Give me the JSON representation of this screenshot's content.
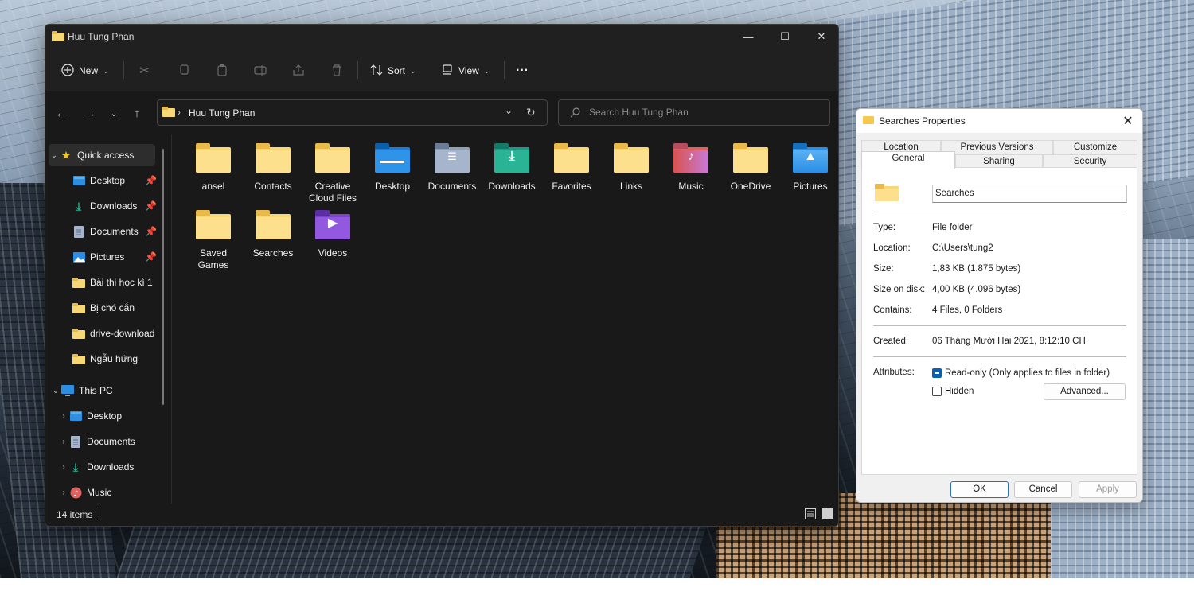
{
  "explorer": {
    "title": "Huu Tung Phan",
    "toolbar": {
      "new_label": "New",
      "sort_label": "Sort",
      "view_label": "View",
      "more_label": "···"
    },
    "address": {
      "path": "Huu Tung Phan",
      "search_placeholder": "Search Huu Tung Phan"
    },
    "sidebar": [
      {
        "label": "Quick access",
        "icon": "star-icon",
        "expanded": true,
        "selected": true
      },
      {
        "label": "Desktop",
        "icon": "desktop-icon",
        "pinned": true
      },
      {
        "label": "Downloads",
        "icon": "download-icon",
        "pinned": true
      },
      {
        "label": "Documents",
        "icon": "documents-icon",
        "pinned": true
      },
      {
        "label": "Pictures",
        "icon": "pictures-icon",
        "pinned": true
      },
      {
        "label": "Bài thi học kì 1",
        "icon": "folder-icon"
      },
      {
        "label": "Bị chó cắn",
        "icon": "folder-icon"
      },
      {
        "label": "drive-download",
        "icon": "folder-icon"
      },
      {
        "label": "Ngẫu hứng",
        "icon": "folder-icon"
      },
      {
        "label": "This PC",
        "icon": "computer-icon",
        "expanded": true
      },
      {
        "label": "Desktop",
        "icon": "desktop-icon"
      },
      {
        "label": "Documents",
        "icon": "documents-icon"
      },
      {
        "label": "Downloads",
        "icon": "download-icon"
      },
      {
        "label": "Music",
        "icon": "music-icon"
      }
    ],
    "items": [
      {
        "name": "ansel",
        "icon": "folder-icon"
      },
      {
        "name": "Contacts",
        "icon": "folder-icon"
      },
      {
        "name": "Creative Cloud Files",
        "icon": "folder-icon"
      },
      {
        "name": "Desktop",
        "icon": "desktop-folder-icon"
      },
      {
        "name": "Documents",
        "icon": "documents-folder-icon"
      },
      {
        "name": "Downloads",
        "icon": "downloads-folder-icon"
      },
      {
        "name": "Favorites",
        "icon": "folder-icon"
      },
      {
        "name": "Links",
        "icon": "folder-icon"
      },
      {
        "name": "Music",
        "icon": "music-folder-icon"
      },
      {
        "name": "OneDrive",
        "icon": "folder-icon"
      },
      {
        "name": "Pictures",
        "icon": "pictures-folder-icon"
      },
      {
        "name": "Saved Games",
        "icon": "folder-icon"
      },
      {
        "name": "Searches",
        "icon": "folder-icon"
      },
      {
        "name": "Videos",
        "icon": "videos-folder-icon"
      }
    ],
    "status": {
      "count": "14 items"
    }
  },
  "properties": {
    "title": "Searches Properties",
    "tabs_row1": [
      "Location",
      "Previous Versions",
      "Customize"
    ],
    "tabs_row2": [
      "General",
      "Sharing",
      "Security"
    ],
    "name": "Searches",
    "type_label": "Type:",
    "type_value": "File folder",
    "location_label": "Location:",
    "location_value": "C:\\Users\\tung2",
    "size_label": "Size:",
    "size_value": "1,83 KB (1.875 bytes)",
    "size_on_disk_label": "Size on disk:",
    "size_on_disk_value": "4,00 KB (4.096 bytes)",
    "contains_label": "Contains:",
    "contains_value": "4 Files, 0 Folders",
    "created_label": "Created:",
    "created_value": "06 Tháng Mười Hai 2021, 8:12:10 CH",
    "attributes_label": "Attributes:",
    "readonly_label": "Read-only (Only applies to files in folder)",
    "hidden_label": "Hidden",
    "advanced_label": "Advanced...",
    "ok_label": "OK",
    "cancel_label": "Cancel",
    "apply_label": "Apply"
  },
  "colors": {
    "explorer_bg": "#191919",
    "folder_yellow": "#f8d775",
    "accent_blue": "#0a5fb4"
  }
}
